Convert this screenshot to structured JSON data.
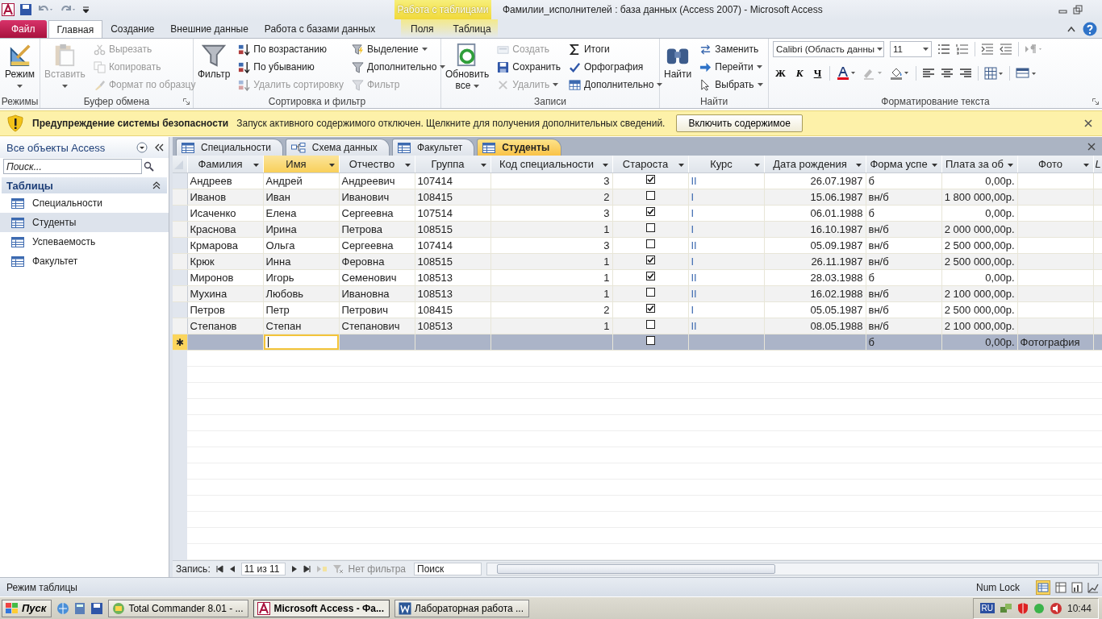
{
  "title_bar": {
    "context_group": "Работа с таблицами",
    "title": "Фамилии_исполнителей : база данных (Access 2007)  -  Microsoft Access"
  },
  "ribbon_tabs": [
    {
      "label": "Файл",
      "kind": "file",
      "selected": false
    },
    {
      "label": "Главная",
      "kind": "normal",
      "selected": true
    },
    {
      "label": "Создание",
      "kind": "normal",
      "selected": false
    },
    {
      "label": "Внешние данные",
      "kind": "normal",
      "selected": false
    },
    {
      "label": "Работа с базами данных",
      "kind": "normal",
      "selected": false
    },
    {
      "label": "Поля",
      "kind": "contextual",
      "selected": false
    },
    {
      "label": "Таблица",
      "kind": "contextual",
      "selected": false
    }
  ],
  "ribbon_groups": [
    {
      "title": "Режимы",
      "kind": "commands",
      "launcher": false,
      "columns": [
        {
          "kind": "large",
          "items": [
            {
              "label": "Режим",
              "disabled": false,
              "dropdown": true
            }
          ]
        }
      ]
    },
    {
      "title": "Буфер обмена",
      "kind": "commands",
      "launcher": true,
      "columns": [
        {
          "kind": "large",
          "items": [
            {
              "label": "Вставить",
              "disabled": true,
              "dropdown": true
            }
          ]
        },
        {
          "kind": "small",
          "items": [
            {
              "label": "Вырезать",
              "disabled": true,
              "dropdown": false
            },
            {
              "label": "Копировать",
              "disabled": true,
              "dropdown": false
            },
            {
              "label": "Формат по образцу",
              "disabled": true,
              "dropdown": false
            }
          ]
        }
      ]
    },
    {
      "title": "Сортировка и фильтр",
      "kind": "commands",
      "launcher": false,
      "columns": [
        {
          "kind": "large",
          "items": [
            {
              "label": "Фильтр",
              "disabled": false,
              "dropdown": false
            }
          ]
        },
        {
          "kind": "small",
          "items": [
            {
              "label": "По возрастанию",
              "disabled": false,
              "dropdown": false
            },
            {
              "label": "По убыванию",
              "disabled": false,
              "dropdown": false
            },
            {
              "label": "Удалить сортировку",
              "disabled": true,
              "dropdown": false
            }
          ]
        },
        {
          "kind": "small",
          "items": [
            {
              "label": "Выделение",
              "disabled": false,
              "dropdown": true
            },
            {
              "label": "Дополнительно",
              "disabled": false,
              "dropdown": true
            },
            {
              "label": "Фильтр",
              "disabled": true,
              "dropdown": false
            }
          ]
        }
      ]
    },
    {
      "title": "Записи",
      "kind": "commands",
      "launcher": false,
      "columns": [
        {
          "kind": "large",
          "items": [
            {
              "label": "Обновить все",
              "disabled": false,
              "dropdown": true
            }
          ]
        },
        {
          "kind": "small",
          "items": [
            {
              "label": "Создать",
              "disabled": true,
              "dropdown": false
            },
            {
              "label": "Сохранить",
              "disabled": false,
              "dropdown": false
            },
            {
              "label": "Удалить",
              "disabled": true,
              "dropdown": true
            }
          ]
        },
        {
          "kind": "small",
          "items": [
            {
              "label": "Итоги",
              "disabled": false,
              "dropdown": false
            },
            {
              "label": "Орфография",
              "disabled": false,
              "dropdown": false
            },
            {
              "label": "Дополнительно",
              "disabled": false,
              "dropdown": true
            }
          ]
        }
      ]
    },
    {
      "title": "Найти",
      "kind": "commands",
      "launcher": false,
      "columns": [
        {
          "kind": "large",
          "items": [
            {
              "label": "Найти",
              "disabled": false,
              "dropdown": false
            }
          ]
        },
        {
          "kind": "small",
          "items": [
            {
              "label": "Заменить",
              "disabled": false,
              "dropdown": false
            },
            {
              "label": "Перейти",
              "disabled": false,
              "dropdown": true
            },
            {
              "label": "Выбрать",
              "disabled": false,
              "dropdown": true
            }
          ]
        }
      ]
    },
    {
      "title": "Форматирование текста",
      "kind": "formatting",
      "launcher": true,
      "font": "Calibri (Область данны",
      "size": "11",
      "style_buttons": [
        "Ж",
        "К",
        "Ч"
      ]
    }
  ],
  "security_bar": {
    "title": "Предупреждение системы безопасности",
    "message": "Запуск активного содержимого отключен. Щелкните для получения дополнительных сведений.",
    "button": "Включить содержимое"
  },
  "nav_pane": {
    "title": "Все объекты Access",
    "search": {
      "placeholder": "Поиск..."
    },
    "section": "Таблицы",
    "items": [
      {
        "label": "Специальности",
        "selected": false
      },
      {
        "label": "Студенты",
        "selected": true
      },
      {
        "label": "Успеваемость",
        "selected": false
      },
      {
        "label": "Факультет",
        "selected": false
      }
    ]
  },
  "doc_tabs": [
    {
      "label": "Специальности",
      "kind": "table",
      "selected": false
    },
    {
      "label": "Схема данных",
      "kind": "diagram",
      "selected": false
    },
    {
      "label": "Факультет",
      "kind": "table",
      "selected": false
    },
    {
      "label": "Студенты",
      "kind": "table",
      "selected": true
    }
  ],
  "table": {
    "columns": [
      {
        "label": "Фамилия",
        "kind": "text",
        "selected": false
      },
      {
        "label": "Имя",
        "kind": "text",
        "selected": true
      },
      {
        "label": "Отчество",
        "kind": "text",
        "selected": false
      },
      {
        "label": "Группа",
        "kind": "text",
        "selected": false
      },
      {
        "label": "Код специальности",
        "kind": "number",
        "selected": false
      },
      {
        "label": "Староста",
        "kind": "check",
        "selected": false
      },
      {
        "label": "Курс",
        "kind": "lookup",
        "selected": false
      },
      {
        "label": "Дата рождения",
        "kind": "date",
        "selected": false
      },
      {
        "label": "Форма успе",
        "kind": "text",
        "selected": false
      },
      {
        "label": "Плата за об",
        "kind": "number",
        "selected": false
      },
      {
        "label": "Фото",
        "kind": "text",
        "selected": false
      },
      {
        "label": "L",
        "kind": "add",
        "selected": false
      }
    ],
    "rows": [
      {
        "cells": [
          "Андреев",
          "Андрей",
          "Андреевич",
          "107414",
          "3",
          "",
          "II",
          "26.07.1987",
          "б",
          "0,00р."
        ],
        "head": true
      },
      {
        "cells": [
          "Иванов",
          "Иван",
          "Иванович",
          "108415",
          "2",
          "",
          "I",
          "15.06.1987",
          "вн/б",
          "1 800 000,00р."
        ],
        "head": false
      },
      {
        "cells": [
          "Исаченко",
          "Елена",
          "Сергеевна",
          "107514",
          "3",
          "",
          "I",
          "06.01.1988",
          "б",
          "0,00р."
        ],
        "head": true
      },
      {
        "cells": [
          "Краснова",
          "Ирина",
          "Петрова",
          "108515",
          "1",
          "",
          "I",
          "16.10.1987",
          "вн/б",
          "2 000 000,00р."
        ],
        "head": false
      },
      {
        "cells": [
          "Крмарова",
          "Ольга",
          "Сергеевна",
          "107414",
          "3",
          "",
          "II",
          "05.09.1987",
          "вн/б",
          "2 500 000,00р."
        ],
        "head": false
      },
      {
        "cells": [
          "Крюк",
          "Инна",
          "Феровна",
          "108515",
          "1",
          "",
          "I",
          "26.11.1987",
          "вн/б",
          "2 500 000,00р."
        ],
        "head": true
      },
      {
        "cells": [
          "Миронов",
          "Игорь",
          "Семенович",
          "108513",
          "1",
          "",
          "II",
          "28.03.1988",
          "б",
          "0,00р."
        ],
        "head": true
      },
      {
        "cells": [
          "Мухина",
          "Любовь",
          "Ивановна",
          "108513",
          "1",
          "",
          "II",
          "16.02.1988",
          "вн/б",
          "2 100 000,00р."
        ],
        "head": false
      },
      {
        "cells": [
          "Петров",
          "Петр",
          "Петрович",
          "108415",
          "2",
          "",
          "I",
          "05.05.1987",
          "вн/б",
          "2 500 000,00р."
        ],
        "head": true
      },
      {
        "cells": [
          "Степанов",
          "Степан",
          "Степанович",
          "108513",
          "1",
          "",
          "II",
          "08.05.1988",
          "вн/б",
          "2 100 000,00р."
        ],
        "head": false
      }
    ],
    "new_row": {
      "marker": "✱",
      "head": false,
      "cells": [
        "",
        "",
        "",
        "",
        "",
        "",
        "",
        "",
        "б",
        "0,00р.",
        "Фотография"
      ]
    }
  },
  "record_nav": {
    "label": "Запись:",
    "position": "11 из 11",
    "filter": "Нет фильтра",
    "search": {
      "placeholder": "Поиск"
    }
  },
  "status_bar": {
    "mode": "Режим таблицы",
    "num_lock": "Num Lock"
  },
  "taskbar": {
    "start": "Пуск",
    "apps": [
      {
        "label": "Total Commander 8.01 - ...",
        "kind": "commander",
        "selected": false
      },
      {
        "label": "Microsoft Access - Фа...",
        "kind": "access",
        "selected": true
      },
      {
        "label": "Лабораторная работа ...",
        "kind": "word",
        "selected": false
      }
    ],
    "language": "RU",
    "clock": "10:44"
  }
}
